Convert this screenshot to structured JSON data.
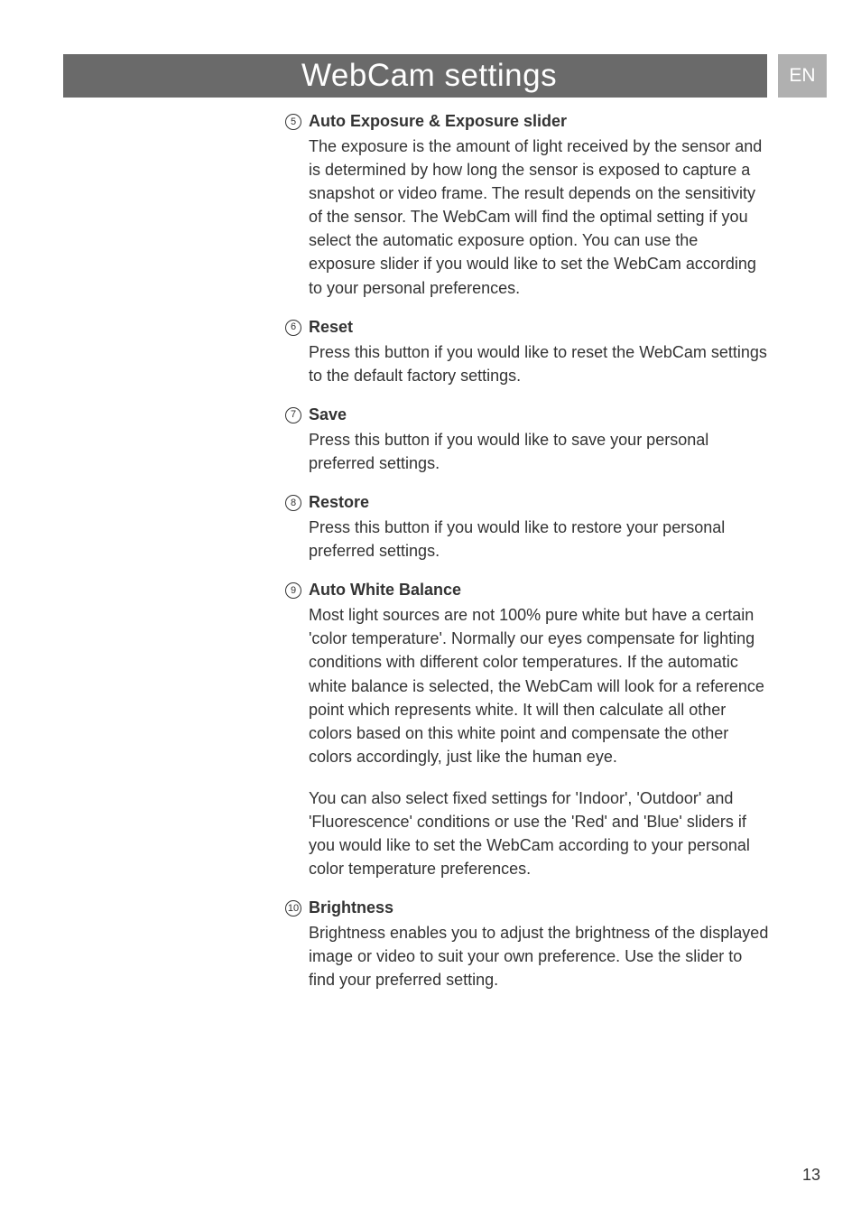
{
  "header": {
    "title": "WebCam settings",
    "lang": "EN"
  },
  "sections": [
    {
      "marker": "5",
      "title": "Auto Exposure & Exposure slider",
      "body": "The exposure is the amount of light received by the sensor and is determined by how long the sensor is exposed to capture a snapshot or video frame. The result depends on the sensitivity of the sensor. The WebCam will find the optimal setting if you select the automatic exposure option. You can use the exposure slider if you would like to set the WebCam according to your personal preferences."
    },
    {
      "marker": "6",
      "title": "Reset",
      "body": "Press this button if you would like to reset the WebCam settings to the default factory settings."
    },
    {
      "marker": "7",
      "title": "Save",
      "body": "Press this button if you would like to save your personal preferred settings."
    },
    {
      "marker": "8",
      "title": "Restore",
      "body": "Press this button if you would like to restore your personal preferred settings."
    },
    {
      "marker": "9",
      "title": "Auto White Balance",
      "body": "Most light sources are not 100% pure white but have a certain 'color temperature'. Normally our eyes compensate for lighting conditions with different color temperatures. If the automatic white balance is selected, the WebCam will look for a reference point which represents white. It will then calculate all other colors based on this white point and compensate the other colors accordingly, just like the human eye.",
      "body2": "You can also select fixed settings for 'Indoor', 'Outdoor' and 'Fluorescence' conditions or use the 'Red' and 'Blue' sliders if you would like to set the WebCam according to your personal color temperature preferences."
    },
    {
      "marker": "10",
      "title": "Brightness",
      "body": "Brightness enables you to adjust the brightness of the displayed image or video to suit your own preference. Use the slider to find your preferred setting."
    }
  ],
  "page_number": "13"
}
